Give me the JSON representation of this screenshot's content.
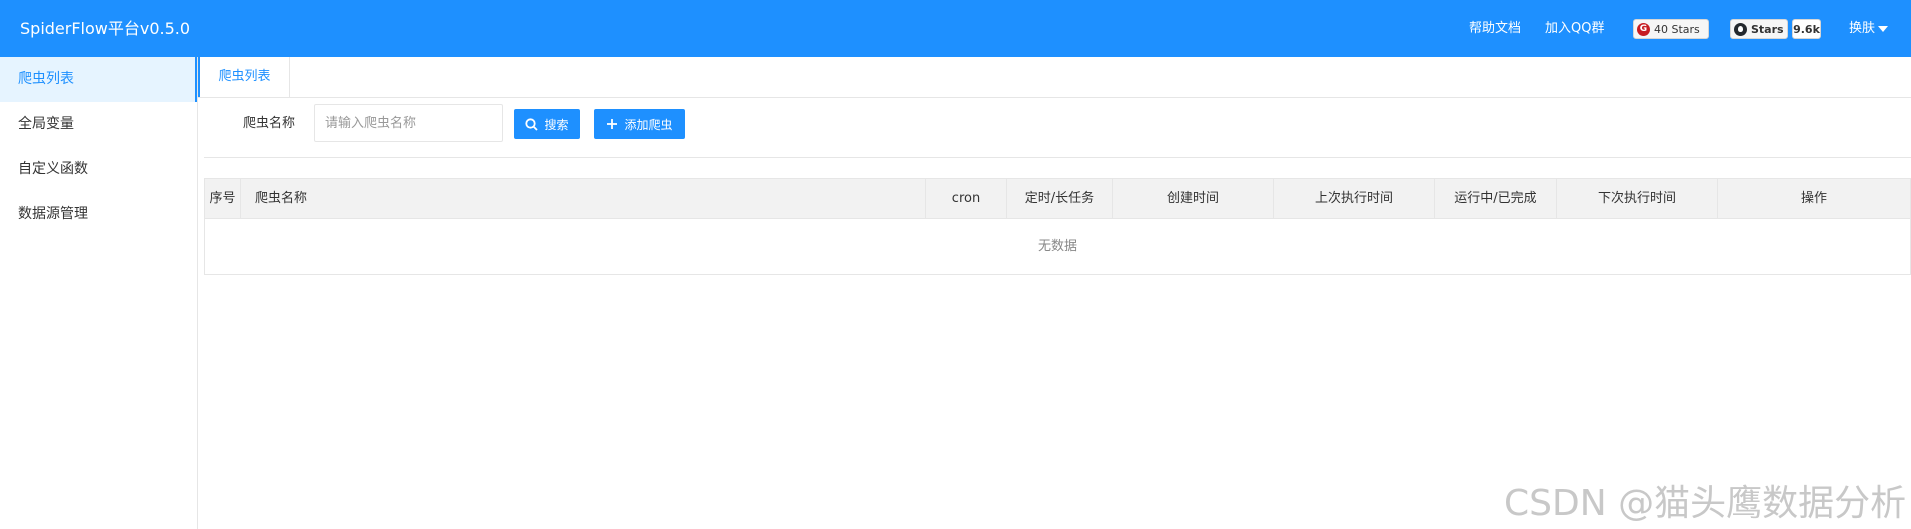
{
  "header": {
    "logo": "SpiderFlow平台v0.5.0",
    "help_link": "帮助文档",
    "qq_link": "加入QQ群",
    "gitee_badge": "40 Stars",
    "github_label": "Stars",
    "github_count": "9.6k",
    "skin_label": "换肤",
    "bg_color": "#1e90ff"
  },
  "sidebar": {
    "items": [
      {
        "label": "爬虫列表",
        "active": true
      },
      {
        "label": "全局变量"
      },
      {
        "label": "自定义函数"
      },
      {
        "label": "数据源管理"
      }
    ]
  },
  "tabs": [
    {
      "label": "爬虫列表"
    }
  ],
  "search": {
    "label": "爬虫名称",
    "placeholder": "请输入爬虫名称",
    "search_button": "搜索",
    "add_button": "添加爬虫"
  },
  "table": {
    "columns": [
      "序号",
      "爬虫名称",
      "cron",
      "定时/长任务",
      "创建时间",
      "上次执行时间",
      "运行中/已完成",
      "下次执行时间",
      "操作"
    ],
    "empty_text": "无数据"
  },
  "watermark": "CSDN @猫头鹰数据分析"
}
